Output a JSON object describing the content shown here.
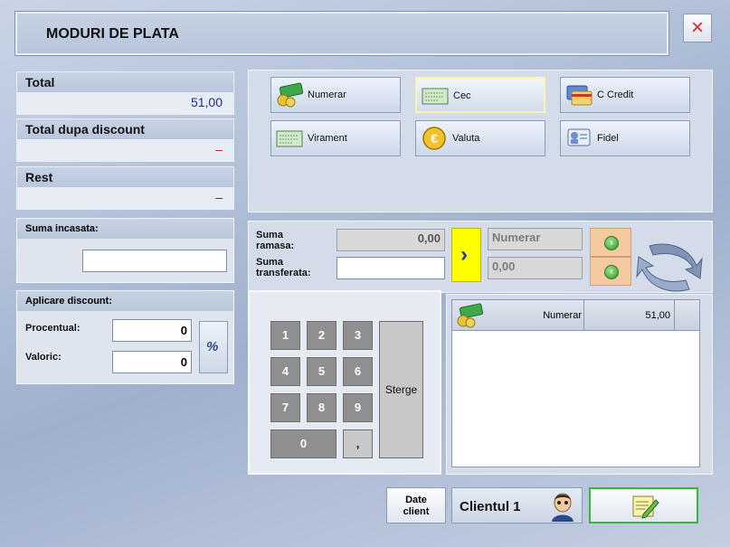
{
  "header": {
    "title": "MODURI DE PLATA",
    "close_icon": "×"
  },
  "summary": {
    "total_label": "Total",
    "total_value": "51,00",
    "discount_label": "Total dupa discount",
    "discount_value": "–",
    "rest_label": "Rest",
    "rest_value": "–"
  },
  "suma_incasata": {
    "label": "Suma incasata:",
    "value": ""
  },
  "discount": {
    "label": "Aplicare discount:",
    "procentual_label": "Procentual:",
    "procentual_value": "0",
    "valoric_label": "Valoric:",
    "valoric_value": "0",
    "percent_icon": "%"
  },
  "payment_methods": [
    {
      "label": "Numerar",
      "icon": "cash-icon"
    },
    {
      "label": "Cec",
      "icon": "cheque-icon",
      "active": true
    },
    {
      "label": "C Credit",
      "icon": "credit-card-icon"
    },
    {
      "label": "Virament",
      "icon": "transfer-icon"
    },
    {
      "label": "Valuta",
      "icon": "euro-coin-icon"
    },
    {
      "label": "Fidel",
      "icon": "loyalty-card-icon"
    }
  ],
  "transfer": {
    "ramasa_label_1": "Suma",
    "ramasa_label_2": "ramasa:",
    "ramasa_value": "0,00",
    "transferata_label_1": "Suma",
    "transferata_label_2": "transferata:",
    "transferata_value": "",
    "method_value": "Numerar",
    "method_amount": "0,00",
    "arrow_icon": "›"
  },
  "keypad": {
    "keys": [
      "1",
      "2",
      "3",
      "4",
      "5",
      "6",
      "7",
      "8",
      "9",
      "0",
      ","
    ],
    "clear_label": "Sterge"
  },
  "payments_table": {
    "rows": [
      {
        "method": "Numerar",
        "amount": "51,00"
      }
    ]
  },
  "footer": {
    "client_data_label_1": "Date",
    "client_data_label_2": "client",
    "client_name": "Clientul 1"
  },
  "colors": {
    "accent_yellow": "#ffff00",
    "orange_btn": "#f5c9a2",
    "confirm_border": "#35b935"
  }
}
